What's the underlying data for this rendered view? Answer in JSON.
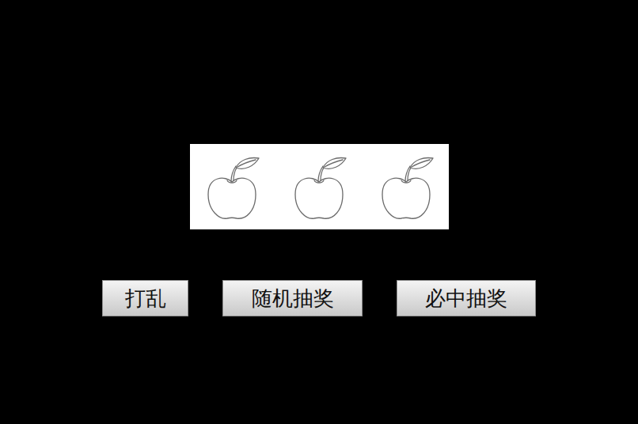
{
  "buttons": [
    {
      "label": "打乱"
    },
    {
      "label": "随机抽奖"
    },
    {
      "label": "必中抽奖"
    }
  ]
}
